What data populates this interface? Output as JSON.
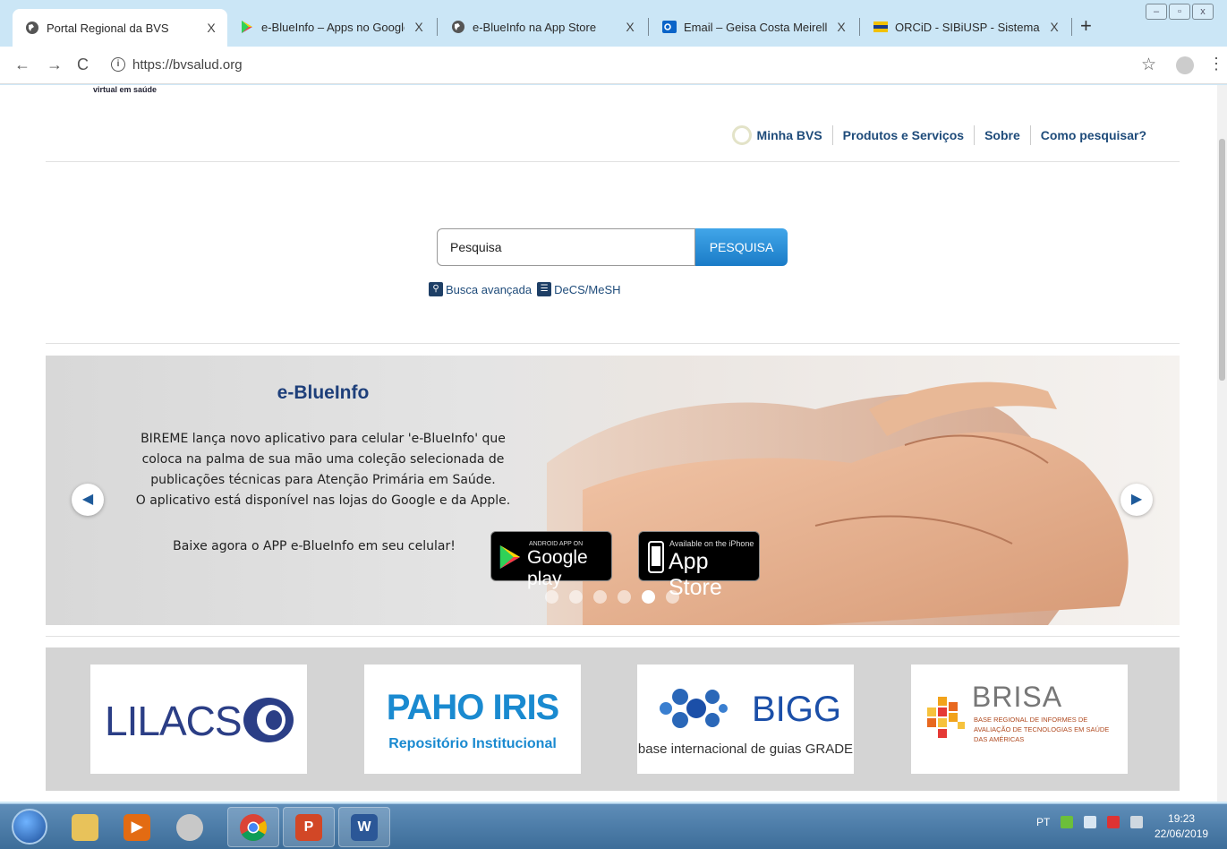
{
  "browser": {
    "tabs": [
      {
        "title": "Portal Regional da BVS",
        "icon": "globe-icon",
        "active": true
      },
      {
        "title": "e-BlueInfo – Apps no Google Pla",
        "icon": "google-play-icon",
        "active": false
      },
      {
        "title": "e-BlueInfo na App Store",
        "icon": "globe-icon",
        "active": false
      },
      {
        "title": "Email – Geisa Costa Meirelles – C",
        "icon": "outlook-icon",
        "active": false
      },
      {
        "title": "ORCiD - SIBiUSP - Sistema Integ",
        "icon": "usp-icon",
        "active": false
      }
    ],
    "close_glyph": "X",
    "new_tab_glyph": "+",
    "url": "https://bvsalud.org"
  },
  "site": {
    "logo_text": "virtual em saúde",
    "nav": {
      "minha": "Minha BVS",
      "produtos": "Produtos e Serviços",
      "sobre": "Sobre",
      "como": "Como pesquisar?"
    },
    "search": {
      "value": "Pesquisa",
      "button": "PESQUISA",
      "advanced": "Busca avançada",
      "decs": "DeCS/MeSH"
    },
    "carousel": {
      "title": "e-BlueInfo",
      "body": [
        "BIREME lança novo aplicativo para celular 'e-BlueInfo' que",
        "coloca na palma de sua mão uma coleção selecionada de",
        "publicações técnicas para Atenção Primária em Saúde.",
        "O aplicativo está disponível nas lojas do Google e da Apple."
      ],
      "cta": "Baixe agora o APP e-BlueInfo em seu celular!",
      "google_small": "ANDROID APP ON",
      "google_big": "Google play",
      "apple_small": "Available on the iPhone",
      "apple_big": "App Store",
      "active_dot": 5,
      "dot_count": 6
    },
    "logos": {
      "lilacs": "LILACS",
      "paho": "PAHO IRIS",
      "paho_sub": "Repositório Institucional",
      "bigg": "BIGG",
      "bigg_sub": "base internacional de guias GRADE",
      "brisa": "BRISA",
      "brisa_sub": "BASE REGIONAL DE INFORMES DE AVALIAÇÃO DE TECNOLOGIAS EM SAÚDE DAS AMÉRICAS"
    }
  },
  "taskbar": {
    "lang": "PT",
    "time": "19:23",
    "date": "22/06/2019"
  },
  "colors": {
    "brand_blue": "#1e4b7a",
    "search_button": "#2a8fdc",
    "chrome_bg": "#cbe6f6"
  }
}
